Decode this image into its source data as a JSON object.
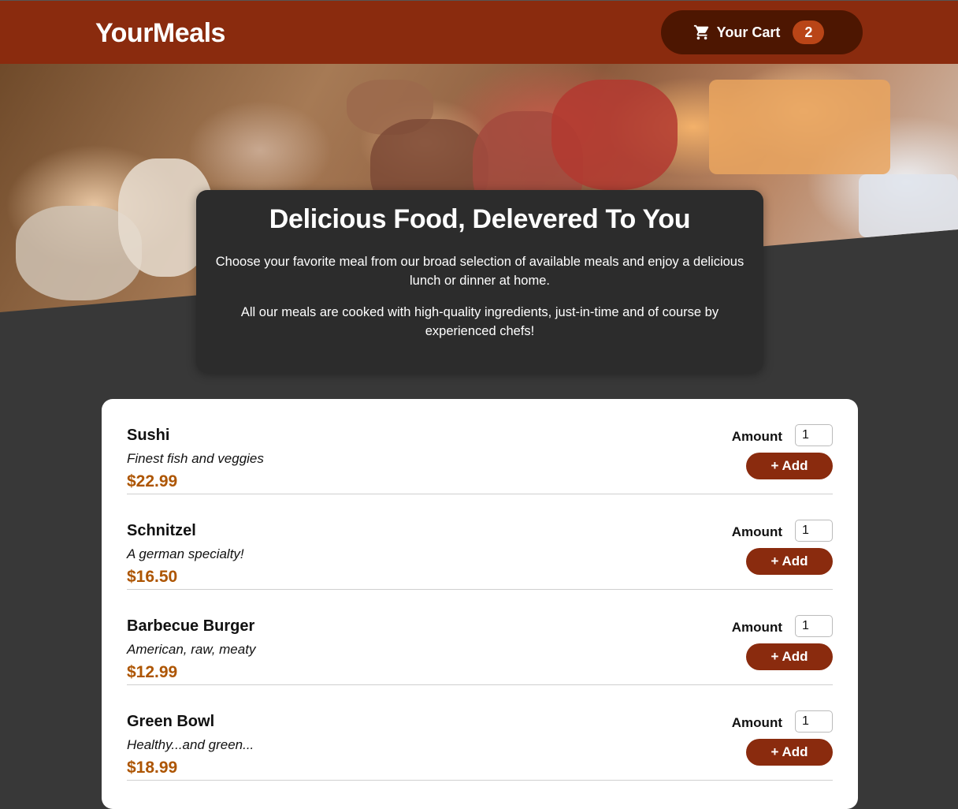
{
  "header": {
    "logo": "YourMeals",
    "cart_label": "Your Cart",
    "cart_count": "2"
  },
  "summary": {
    "title": "Delicious Food, Delevered To You",
    "paragraph1": "Choose your favorite meal from our broad selection of available meals and enjoy a delicious lunch or dinner at home.",
    "paragraph2": "All our meals are cooked with high-quality ingredients, just-in-time and of course by experienced chefs!"
  },
  "meals": [
    {
      "name": "Sushi",
      "description": "Finest fish and veggies",
      "price": "$22.99",
      "amount_label": "Amount",
      "amount": "1",
      "add_label": "+ Add"
    },
    {
      "name": "Schnitzel",
      "description": "A german specialty!",
      "price": "$16.50",
      "amount_label": "Amount",
      "amount": "1",
      "add_label": "+ Add"
    },
    {
      "name": "Barbecue Burger",
      "description": "American, raw, meaty",
      "price": "$12.99",
      "amount_label": "Amount",
      "amount": "1",
      "add_label": "+ Add"
    },
    {
      "name": "Green Bowl",
      "description": "Healthy...and green...",
      "price": "$18.99",
      "amount_label": "Amount",
      "amount": "1",
      "add_label": "+ Add"
    }
  ],
  "colors": {
    "header": "#8a2b0e",
    "cart_button": "#4d1601",
    "badge": "#b94517",
    "price": "#ad5502",
    "background": "#383838"
  },
  "icons": {
    "cart": "shopping-cart-icon"
  }
}
